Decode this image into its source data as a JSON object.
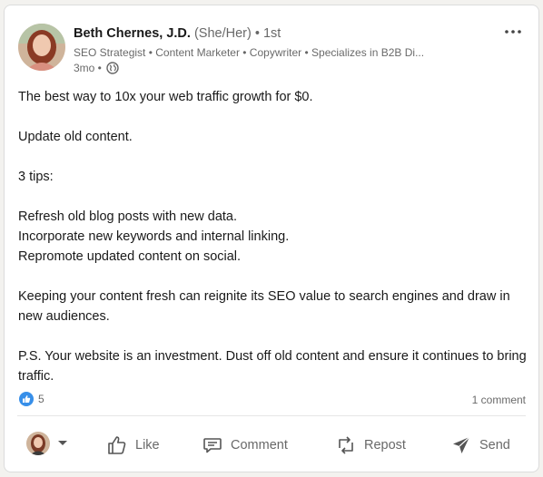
{
  "post": {
    "author": {
      "name": "Beth Chernes, J.D.",
      "pronouns": "(She/Her)",
      "degree": "• 1st",
      "headline": "SEO Strategist • Content Marketer • Copywriter • Specializes in B2B Di...",
      "time": "3mo •"
    },
    "body": [
      "The best way to 10x your web traffic growth for $0.",
      "",
      "Update old content.",
      "",
      "3 tips:",
      "",
      "Refresh old blog posts with new data.",
      "Incorporate new keywords and internal linking.",
      "Repromote updated content on social.",
      "",
      "Keeping your content fresh can reignite its SEO value to search engines and draw in new audiences.",
      "",
      "P.S. Your website is an investment. Dust off old content and ensure it continues to bring traffic."
    ],
    "reactions_count": "5",
    "comments_count": "1 comment"
  },
  "actions": {
    "like": "Like",
    "comment": "Comment",
    "repost": "Repost",
    "send": "Send"
  },
  "icons": [
    "more-icon",
    "globe-icon",
    "like-reaction-icon",
    "chevron-down-icon",
    "like-icon",
    "comment-icon",
    "repost-icon",
    "send-icon"
  ],
  "colors": {
    "reaction_blue": "#378fe9",
    "text_secondary": "#666666"
  }
}
